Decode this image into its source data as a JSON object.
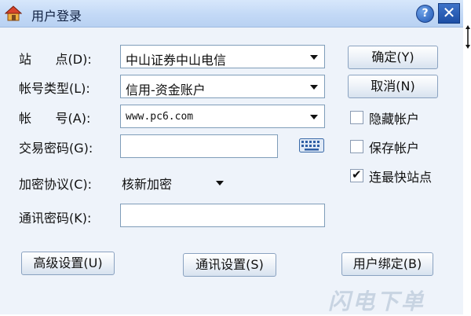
{
  "window": {
    "title": "用户登录"
  },
  "icons": {
    "app": "house-icon",
    "help": "help-icon",
    "close": "close-icon",
    "keyboard": "keyboard-icon"
  },
  "titlebar": {
    "help_label": "?",
    "close_label": "✕"
  },
  "form": {
    "site": {
      "label": "站      点(D):",
      "value": "中山证券中山电信"
    },
    "account_type": {
      "label": "帐号类型(L):",
      "value": "信用-资金账户"
    },
    "account": {
      "label": "帐      号(A):",
      "value": "www.pc6.com"
    },
    "trade_password": {
      "label": "交易密码(G):",
      "value": ""
    },
    "encryption": {
      "label": "加密协议(C):",
      "value": "核新加密"
    },
    "comm_password": {
      "label": "通讯密码(K):",
      "value": ""
    }
  },
  "buttons": {
    "ok": "确定(Y)",
    "cancel": "取消(N)",
    "advanced": "高级设置(U)",
    "comm_settings": "通讯设置(S)",
    "user_bind": "用户绑定(B)"
  },
  "options": {
    "hide_account": {
      "label": "隐藏帐户",
      "checked": false
    },
    "save_account": {
      "label": "保存帐户",
      "checked": false
    },
    "fastest_site": {
      "label": "连最快站点",
      "checked": true
    }
  },
  "watermark": "闪电下单",
  "colors": {
    "titlebar": "#c3d9f6",
    "window_bg": "#eef3fa",
    "field_border": "#7f9db9"
  }
}
